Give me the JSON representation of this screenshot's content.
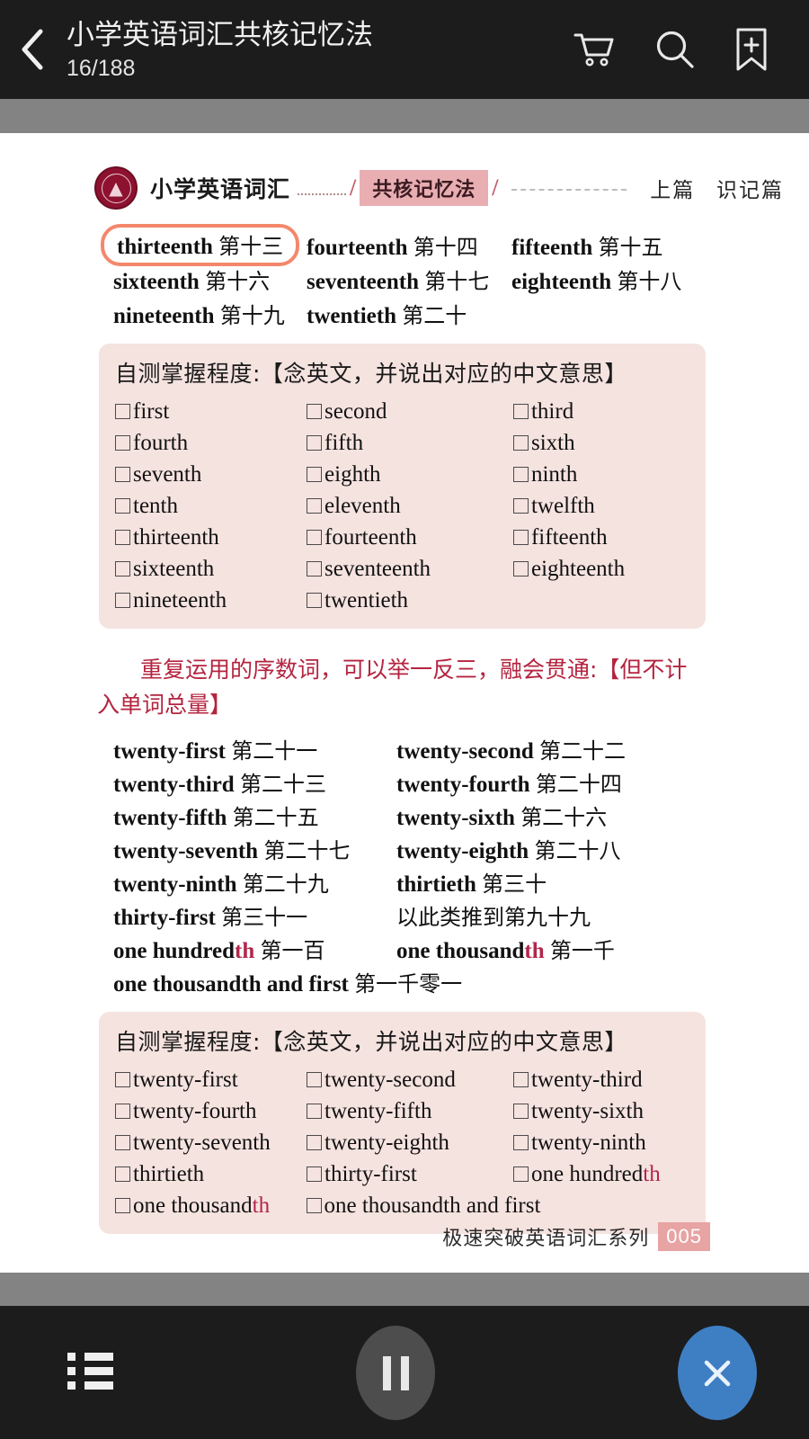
{
  "topbar": {
    "back_icon": "chevron-left-icon",
    "book_title": "小学英语词汇共核记忆法",
    "page_count": "16/188",
    "actions": [
      {
        "name": "cart-icon",
        "label": "购物车"
      },
      {
        "name": "search-icon",
        "label": "搜索"
      },
      {
        "name": "bookmark-add-icon",
        "label": "添加书签"
      }
    ]
  },
  "page": {
    "runhead": {
      "logo": "seal-logo",
      "series_name": "小学英语词汇",
      "chip": "共核记忆法",
      "right_1": "上篇",
      "right_2": "识记篇"
    },
    "word_list_top": [
      [
        {
          "en": "thirteenth",
          "cn": "第十三",
          "highlight": true
        },
        {
          "en": "fourteenth",
          "cn": "第十四",
          "highlight": false
        },
        {
          "en": "fifteenth",
          "cn": "第十五",
          "highlight": false
        }
      ],
      [
        {
          "en": "sixteenth",
          "cn": "第十六",
          "highlight": false
        },
        {
          "en": "seventeenth",
          "cn": "第十七",
          "highlight": false
        },
        {
          "en": "eighteenth",
          "cn": "第十八",
          "highlight": false
        }
      ],
      [
        {
          "en": "nineteenth",
          "cn": "第十九",
          "highlight": false
        },
        {
          "en": "twentieth",
          "cn": "第二十",
          "highlight": false
        },
        {
          "en": "",
          "cn": "",
          "highlight": false
        }
      ]
    ],
    "testbox_1": {
      "title": "自测掌握程度:【念英文，并说出对应的中文意思】",
      "rows": [
        [
          "first",
          "second",
          "third"
        ],
        [
          "fourth",
          "fifth",
          "sixth"
        ],
        [
          "seventh",
          "eighth",
          "ninth"
        ],
        [
          "tenth",
          "eleventh",
          "twelfth"
        ],
        [
          "thirteenth",
          "fourteenth",
          "fifteenth"
        ],
        [
          "sixteenth",
          "seventeenth",
          "eighteenth"
        ],
        [
          "nineteenth",
          "twentieth",
          ""
        ]
      ]
    },
    "red_note": "重复运用的序数词，可以举一反三，融会贯通:【但不计入单词总量】",
    "word_list_bottom": [
      [
        {
          "en": "twenty-first",
          "cn": "第二十一",
          "th": ""
        },
        {
          "en": "twenty-second",
          "cn": "第二十二",
          "th": ""
        }
      ],
      [
        {
          "en": "twenty-third",
          "cn": "第二十三",
          "th": ""
        },
        {
          "en": "twenty-fourth",
          "cn": "第二十四",
          "th": ""
        }
      ],
      [
        {
          "en": "twenty-fifth",
          "cn": "第二十五",
          "th": ""
        },
        {
          "en": "twenty-sixth",
          "cn": "第二十六",
          "th": ""
        }
      ],
      [
        {
          "en": "twenty-seventh",
          "cn": "第二十七",
          "th": ""
        },
        {
          "en": "twenty-eighth",
          "cn": "第二十八",
          "th": ""
        }
      ],
      [
        {
          "en": "twenty-ninth",
          "cn": "第二十九",
          "th": ""
        },
        {
          "en": "thirtieth",
          "cn": "第三十",
          "th": ""
        }
      ],
      [
        {
          "en": "thirty-first",
          "cn": "第三十一",
          "th": ""
        },
        {
          "en": "",
          "cn": "以此类推到第九十九",
          "th": ""
        }
      ],
      [
        {
          "en": "one hundred",
          "cn": "第一百",
          "th": "th"
        },
        {
          "en": "one thousand",
          "cn": "第一千",
          "th": "th"
        }
      ],
      [
        {
          "en": "one thousandth and first",
          "cn": "第一千零一",
          "th": ""
        },
        {
          "en": "",
          "cn": "",
          "th": ""
        }
      ]
    ],
    "testbox_2": {
      "title": "自测掌握程度:【念英文，并说出对应的中文意思】",
      "rows": [
        [
          {
            "t": "twenty-first",
            "th": ""
          },
          {
            "t": "twenty-second",
            "th": ""
          },
          {
            "t": "twenty-third",
            "th": ""
          }
        ],
        [
          {
            "t": "twenty-fourth",
            "th": ""
          },
          {
            "t": "twenty-fifth",
            "th": ""
          },
          {
            "t": "twenty-sixth",
            "th": ""
          }
        ],
        [
          {
            "t": "twenty-seventh",
            "th": ""
          },
          {
            "t": "twenty-eighth",
            "th": ""
          },
          {
            "t": "twenty-ninth",
            "th": ""
          }
        ],
        [
          {
            "t": "thirtieth",
            "th": ""
          },
          {
            "t": "thirty-first",
            "th": ""
          },
          {
            "t": "one hundred",
            "th": "th"
          }
        ],
        [
          {
            "t": "one thousand",
            "th": "th"
          },
          {
            "t": "one thousandth and first",
            "th": ""
          },
          {
            "t": "",
            "th": ""
          }
        ]
      ]
    },
    "footer": {
      "series": "极速突破英语词汇系列",
      "page_number": "005"
    }
  },
  "bottombar": {
    "list_icon": "list-icon",
    "pause_icon": "pause-icon",
    "close_icon": "close-icon"
  },
  "colors": {
    "topbar_bg": "#1c1c1c",
    "gray_band": "#838383",
    "highlight_ring": "#f4876b",
    "testbox_bg": "#f5e3df",
    "red_note": "#b4243f",
    "chip_bg": "#e8aeb2",
    "seal": "#8e1230",
    "close_button": "#3e7fc4",
    "page_badge": "#e8a3a3",
    "red_th": "#b3264a"
  }
}
